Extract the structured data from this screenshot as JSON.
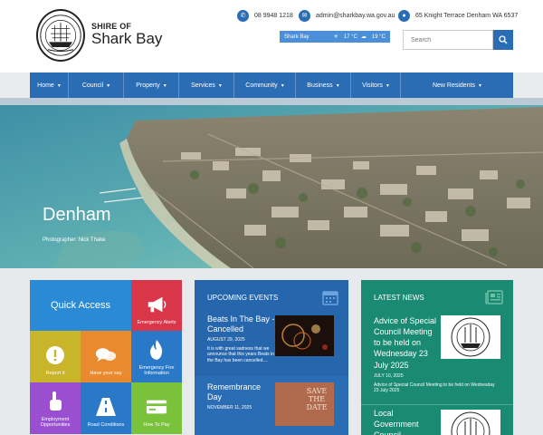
{
  "brand": {
    "top": "SHIRE OF",
    "main": "Shark Bay"
  },
  "contact": {
    "phone": "08 9948 1218",
    "email": "admin@sharkbay.wa.gov.au",
    "address": "65 Knight Terrace Denham WA 6537"
  },
  "weather": {
    "location": "Shark Bay",
    "temp_high": "17 °C",
    "temp_low": "19 °C"
  },
  "search": {
    "placeholder": "Search"
  },
  "nav": [
    {
      "label": "Home"
    },
    {
      "label": "Council"
    },
    {
      "label": "Property"
    },
    {
      "label": "Services"
    },
    {
      "label": "Community"
    },
    {
      "label": "Business"
    },
    {
      "label": "Visitors"
    },
    {
      "label": "New Residents"
    }
  ],
  "hero": {
    "title": "Denham",
    "credit": "Photographer: Nick Thake"
  },
  "quick_access": {
    "title": "Quick Access",
    "tiles": [
      {
        "label": "Emergency Alerts",
        "color": "#d9364a",
        "icon": "megaphone-icon"
      },
      {
        "label": "Report it",
        "color": "#c9b52a",
        "icon": "alert-circle-icon"
      },
      {
        "label": "Have your say",
        "color": "#e98a2e",
        "icon": "chat-bubbles-icon"
      },
      {
        "label": "Emergency Fire Information",
        "color": "#2a78c8",
        "icon": "flame-icon"
      },
      {
        "label": "Employment Opportunities",
        "color": "#9a4fd0",
        "icon": "pointing-hand-icon"
      },
      {
        "label": "Road Conditions",
        "color": "#2a78c8",
        "icon": "road-icon"
      },
      {
        "label": "How To Pay",
        "color": "#7ac13c",
        "icon": "card-icon"
      }
    ]
  },
  "events": {
    "title": "Upcoming Events",
    "items": [
      {
        "title": "Beats In The Bay - Cancelled",
        "date": "AUGUST 29, 2025",
        "desc": "It is with great sadness that we announce that this years Beats in the Bay has been cancelled...."
      },
      {
        "title": "Remembrance Day",
        "date": "NOVEMBER 11, 2025",
        "desc": "",
        "thumb_text": "SAVE THE DATE"
      }
    ]
  },
  "news": {
    "title": "Latest News",
    "items": [
      {
        "title": "Advice of Special Council Meeting to be held on Wednesday 23 July 2025",
        "date": "JULY 10, 2025",
        "desc": "Advice of Special Council Meeting to be held on Wednesday 23 July 2025"
      },
      {
        "title": "Local Government Council...",
        "date": "",
        "desc": ""
      }
    ]
  },
  "colors": {
    "primary": "#2a6db5",
    "events_bg": "#2566ad",
    "news_bg": "#1a8a72"
  }
}
